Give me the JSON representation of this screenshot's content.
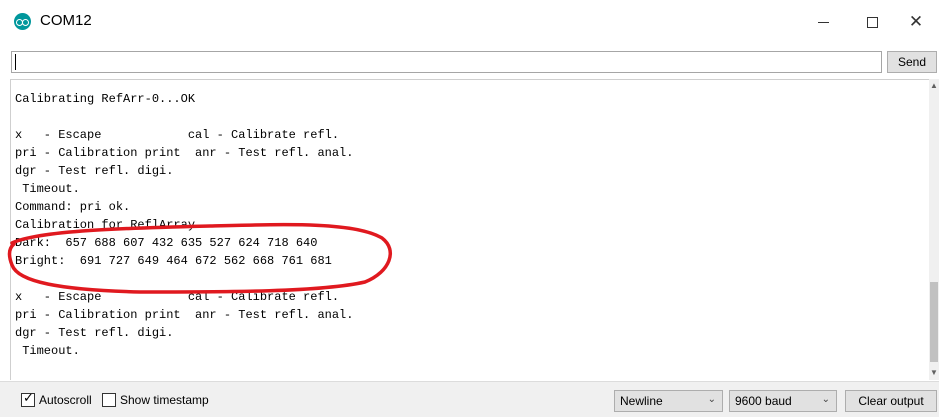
{
  "window": {
    "title": "COM12",
    "icon": "arduino-icon"
  },
  "window_controls": {
    "minimize": "minimize-icon",
    "maximize": "maximize-icon",
    "close": "close-icon"
  },
  "input": {
    "value": "",
    "send_label": "Send"
  },
  "output_lines": [
    "Calibrating RefArr-0...OK",
    "",
    "x   - Escape            cal - Calibrate refl.",
    "pri - Calibration print  anr - Test refl. anal.",
    "dgr - Test refl. digi.",
    " Timeout.",
    "Command: pri ok.",
    "Calibration for ReflArray.",
    "Dark:  657 688 607 432 635 527 624 718 640",
    "Bright:  691 727 649 464 672 562 668 761 681",
    "",
    "x   - Escape            cal - Calibrate refl.",
    "pri - Calibration print  anr - Test refl. anal.",
    "dgr - Test refl. digi.",
    " Timeout."
  ],
  "annotation": {
    "color": "#e0191f"
  },
  "bottom": {
    "autoscroll_label": "Autoscroll",
    "autoscroll_checked": true,
    "timestamp_label": "Show timestamp",
    "timestamp_checked": false,
    "line_ending": "Newline",
    "baud": "9600 baud",
    "clear_label": "Clear output"
  }
}
